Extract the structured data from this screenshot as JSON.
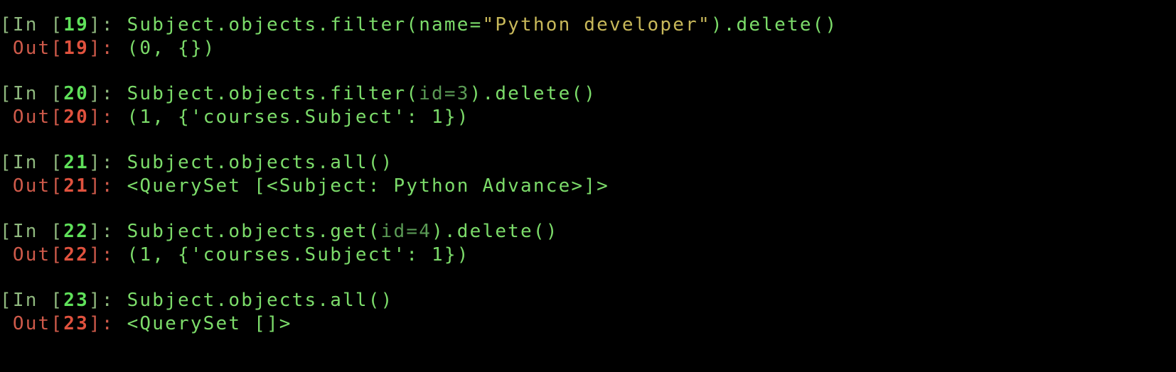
{
  "cells": [
    {
      "in_prefix": "[In [",
      "in_number": "19",
      "in_suffix": "]: ",
      "code": {
        "pre": "Subject.objects.filter(name=",
        "string": "\"Python developer\"",
        "post": ").delete()"
      },
      "out_prefix": " Out[",
      "out_number": "19",
      "out_suffix": "]: ",
      "output": "(0, {})"
    },
    {
      "in_prefix": "[In [",
      "in_number": "20",
      "in_suffix": "]: ",
      "code": {
        "pre": "Subject.objects.filter(",
        "kwarg": "id=3",
        "post": ").delete()"
      },
      "out_prefix": " Out[",
      "out_number": "20",
      "out_suffix": "]: ",
      "output": "(1, {'courses.Subject': 1})"
    },
    {
      "in_prefix": "[In [",
      "in_number": "21",
      "in_suffix": "]: ",
      "code": {
        "text": "Subject.objects.all()"
      },
      "out_prefix": " Out[",
      "out_number": "21",
      "out_suffix": "]: ",
      "output": "<QuerySet [<Subject: Python Advance>]>"
    },
    {
      "in_prefix": "[In [",
      "in_number": "22",
      "in_suffix": "]: ",
      "code": {
        "pre": "Subject.objects.get(",
        "kwarg": "id=4",
        "post": ").delete()"
      },
      "out_prefix": " Out[",
      "out_number": "22",
      "out_suffix": "]: ",
      "output": "(1, {'courses.Subject': 1})"
    },
    {
      "in_prefix": "[In [",
      "in_number": "23",
      "in_suffix": "]: ",
      "code": {
        "text": "Subject.objects.all()"
      },
      "out_prefix": " Out[",
      "out_number": "23",
      "out_suffix": "]: ",
      "output": "<QuerySet []>"
    }
  ],
  "colors": {
    "background": "#000000",
    "code_text": "#7cdc6a",
    "in_prompt": "#8fb87e",
    "in_number": "#5fe05a",
    "out_prompt": "#cf5a4a",
    "out_number": "#e0523e",
    "string_literal": "#c8b85a",
    "keyword_argument": "#5a9a55"
  }
}
